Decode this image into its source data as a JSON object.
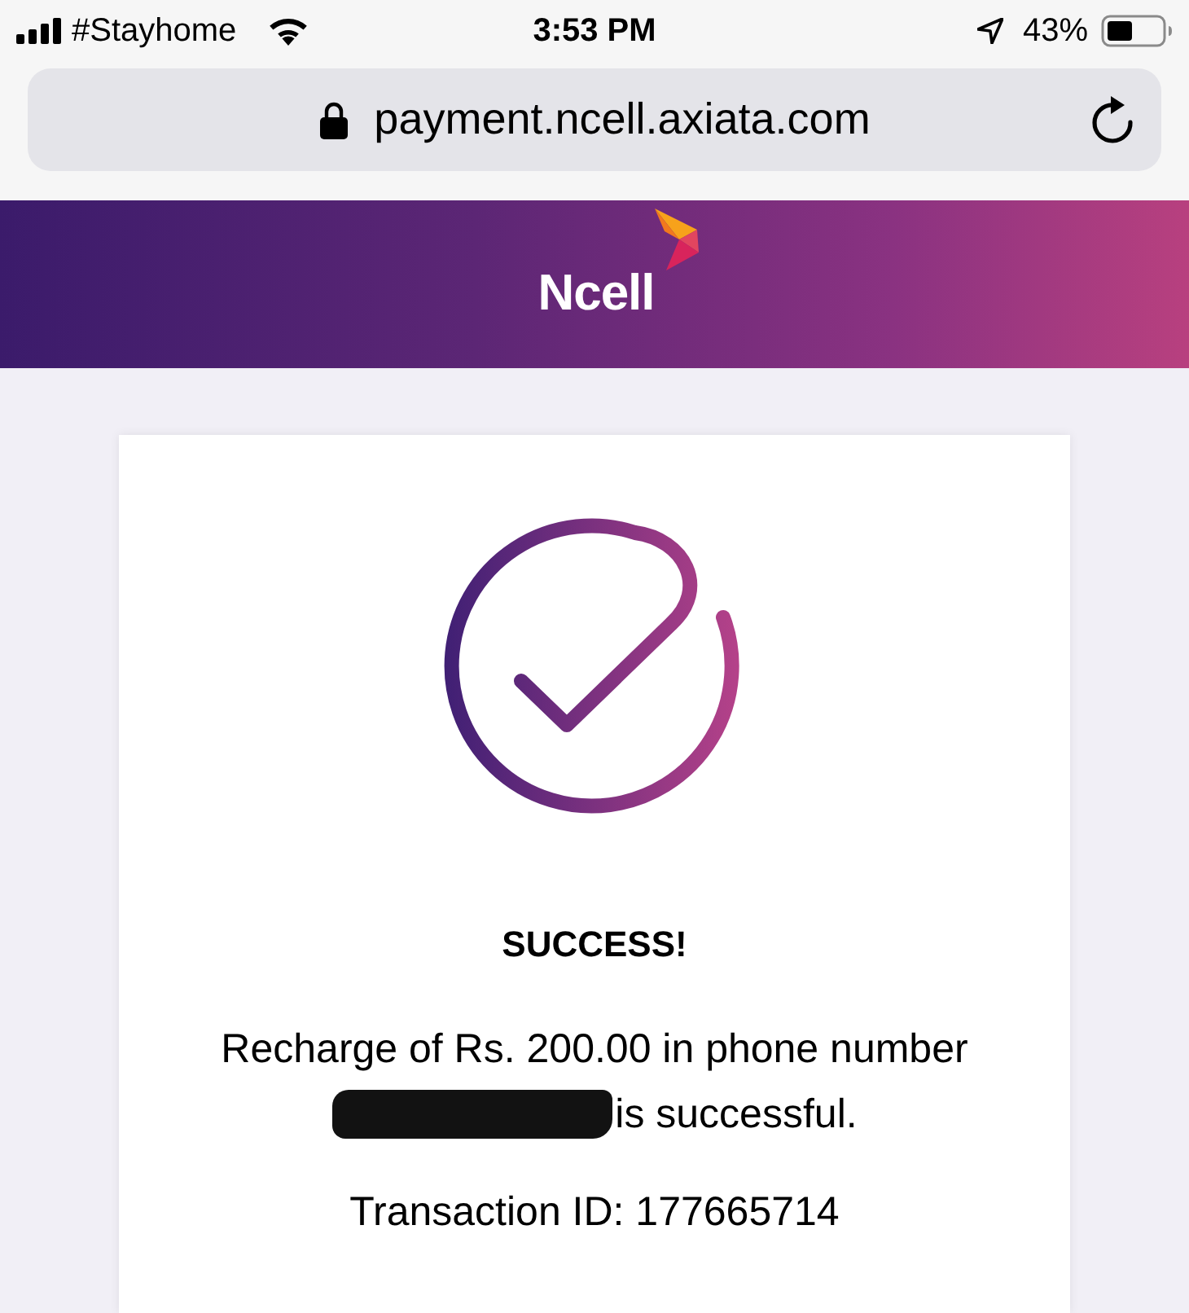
{
  "status_bar": {
    "carrier": "#Stayhome",
    "time": "3:53 PM",
    "battery": "43%"
  },
  "browser": {
    "url": "payment.ncell.axiata.com"
  },
  "header": {
    "logo_text": "Ncell"
  },
  "result": {
    "title": "SUCCESS!",
    "message_before": "Recharge of Rs. 200.00 in phone number",
    "phone_redacted": true,
    "message_after": "is successful.",
    "transaction": "Transaction ID: 177665714"
  }
}
